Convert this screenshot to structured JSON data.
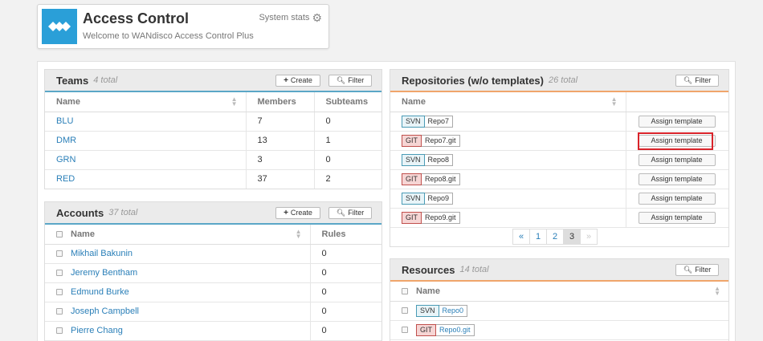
{
  "header": {
    "title": "Access Control",
    "subtitle": "Welcome to WANdisco Access Control Plus",
    "system_stats": "System stats"
  },
  "teams": {
    "title": "Teams",
    "count": "4 total",
    "create_label": "Create",
    "filter_label": "Filter",
    "columns": [
      "Name",
      "Members",
      "Subteams"
    ],
    "rows": [
      {
        "name": "BLU",
        "members": "7",
        "subteams": "0"
      },
      {
        "name": "DMR",
        "members": "13",
        "subteams": "1"
      },
      {
        "name": "GRN",
        "members": "3",
        "subteams": "0"
      },
      {
        "name": "RED",
        "members": "37",
        "subteams": "2"
      }
    ]
  },
  "accounts": {
    "title": "Accounts",
    "count": "37 total",
    "create_label": "Create",
    "filter_label": "Filter",
    "columns": [
      "Name",
      "Rules"
    ],
    "rows": [
      {
        "name": "Mikhail Bakunin",
        "rules": "0"
      },
      {
        "name": "Jeremy Bentham",
        "rules": "0"
      },
      {
        "name": "Edmund Burke",
        "rules": "0"
      },
      {
        "name": "Joseph Campbell",
        "rules": "0"
      },
      {
        "name": "Pierre Chang",
        "rules": "0"
      }
    ]
  },
  "repositories": {
    "title": "Repositories (w/o templates)",
    "count": "26 total",
    "filter_label": "Filter",
    "columns": [
      "Name",
      ""
    ],
    "assign_label": "Assign template",
    "rows": [
      {
        "type": "SVN",
        "name": "Repo7"
      },
      {
        "type": "GIT",
        "name": "Repo7.git"
      },
      {
        "type": "SVN",
        "name": "Repo8"
      },
      {
        "type": "GIT",
        "name": "Repo8.git"
      },
      {
        "type": "SVN",
        "name": "Repo9"
      },
      {
        "type": "GIT",
        "name": "Repo9.git"
      }
    ],
    "pagination": {
      "prev": "«",
      "pages": [
        "1",
        "2",
        "3"
      ],
      "current": "3",
      "next": "»"
    }
  },
  "resources": {
    "title": "Resources",
    "count": "14 total",
    "filter_label": "Filter",
    "columns": [
      "Name"
    ],
    "rows": [
      {
        "type": "SVN",
        "name": "Repo0"
      },
      {
        "type": "GIT",
        "name": "Repo0.git"
      }
    ]
  },
  "colors": {
    "brand": "#2a9fd8",
    "link": "#2a7fb8",
    "svn": "#4a9bb5",
    "git": "#c0504d",
    "highlight": "#d9232a"
  }
}
